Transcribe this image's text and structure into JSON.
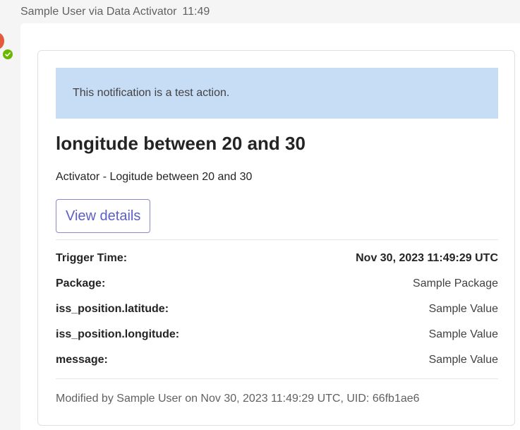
{
  "message": {
    "sender": "Sample User via Data Activator",
    "time": "11:49"
  },
  "colors": {
    "banner_bg": "#c7dcf5",
    "accent": "#5b5fc7",
    "presence_available": "#6bb700",
    "avatar": "#e35a3c"
  },
  "card": {
    "banner_text": "This notification is a test action.",
    "title": "longitude between 20 and 30",
    "subtitle": "Activator - Logitude between 20 and 30",
    "view_details_label": "View details",
    "facts": [
      {
        "key": "Trigger Time:",
        "value": "Nov 30, 2023 11:49:29 UTC"
      },
      {
        "key": "Package:",
        "value": "Sample Package"
      },
      {
        "key": "iss_position.latitude:",
        "value": "Sample Value"
      },
      {
        "key": "iss_position.longitude:",
        "value": "Sample Value"
      },
      {
        "key": "message:",
        "value": "Sample Value"
      }
    ],
    "footer": "Modified by Sample User on Nov 30, 2023 11:49:29 UTC, UID: 66fb1ae6"
  }
}
